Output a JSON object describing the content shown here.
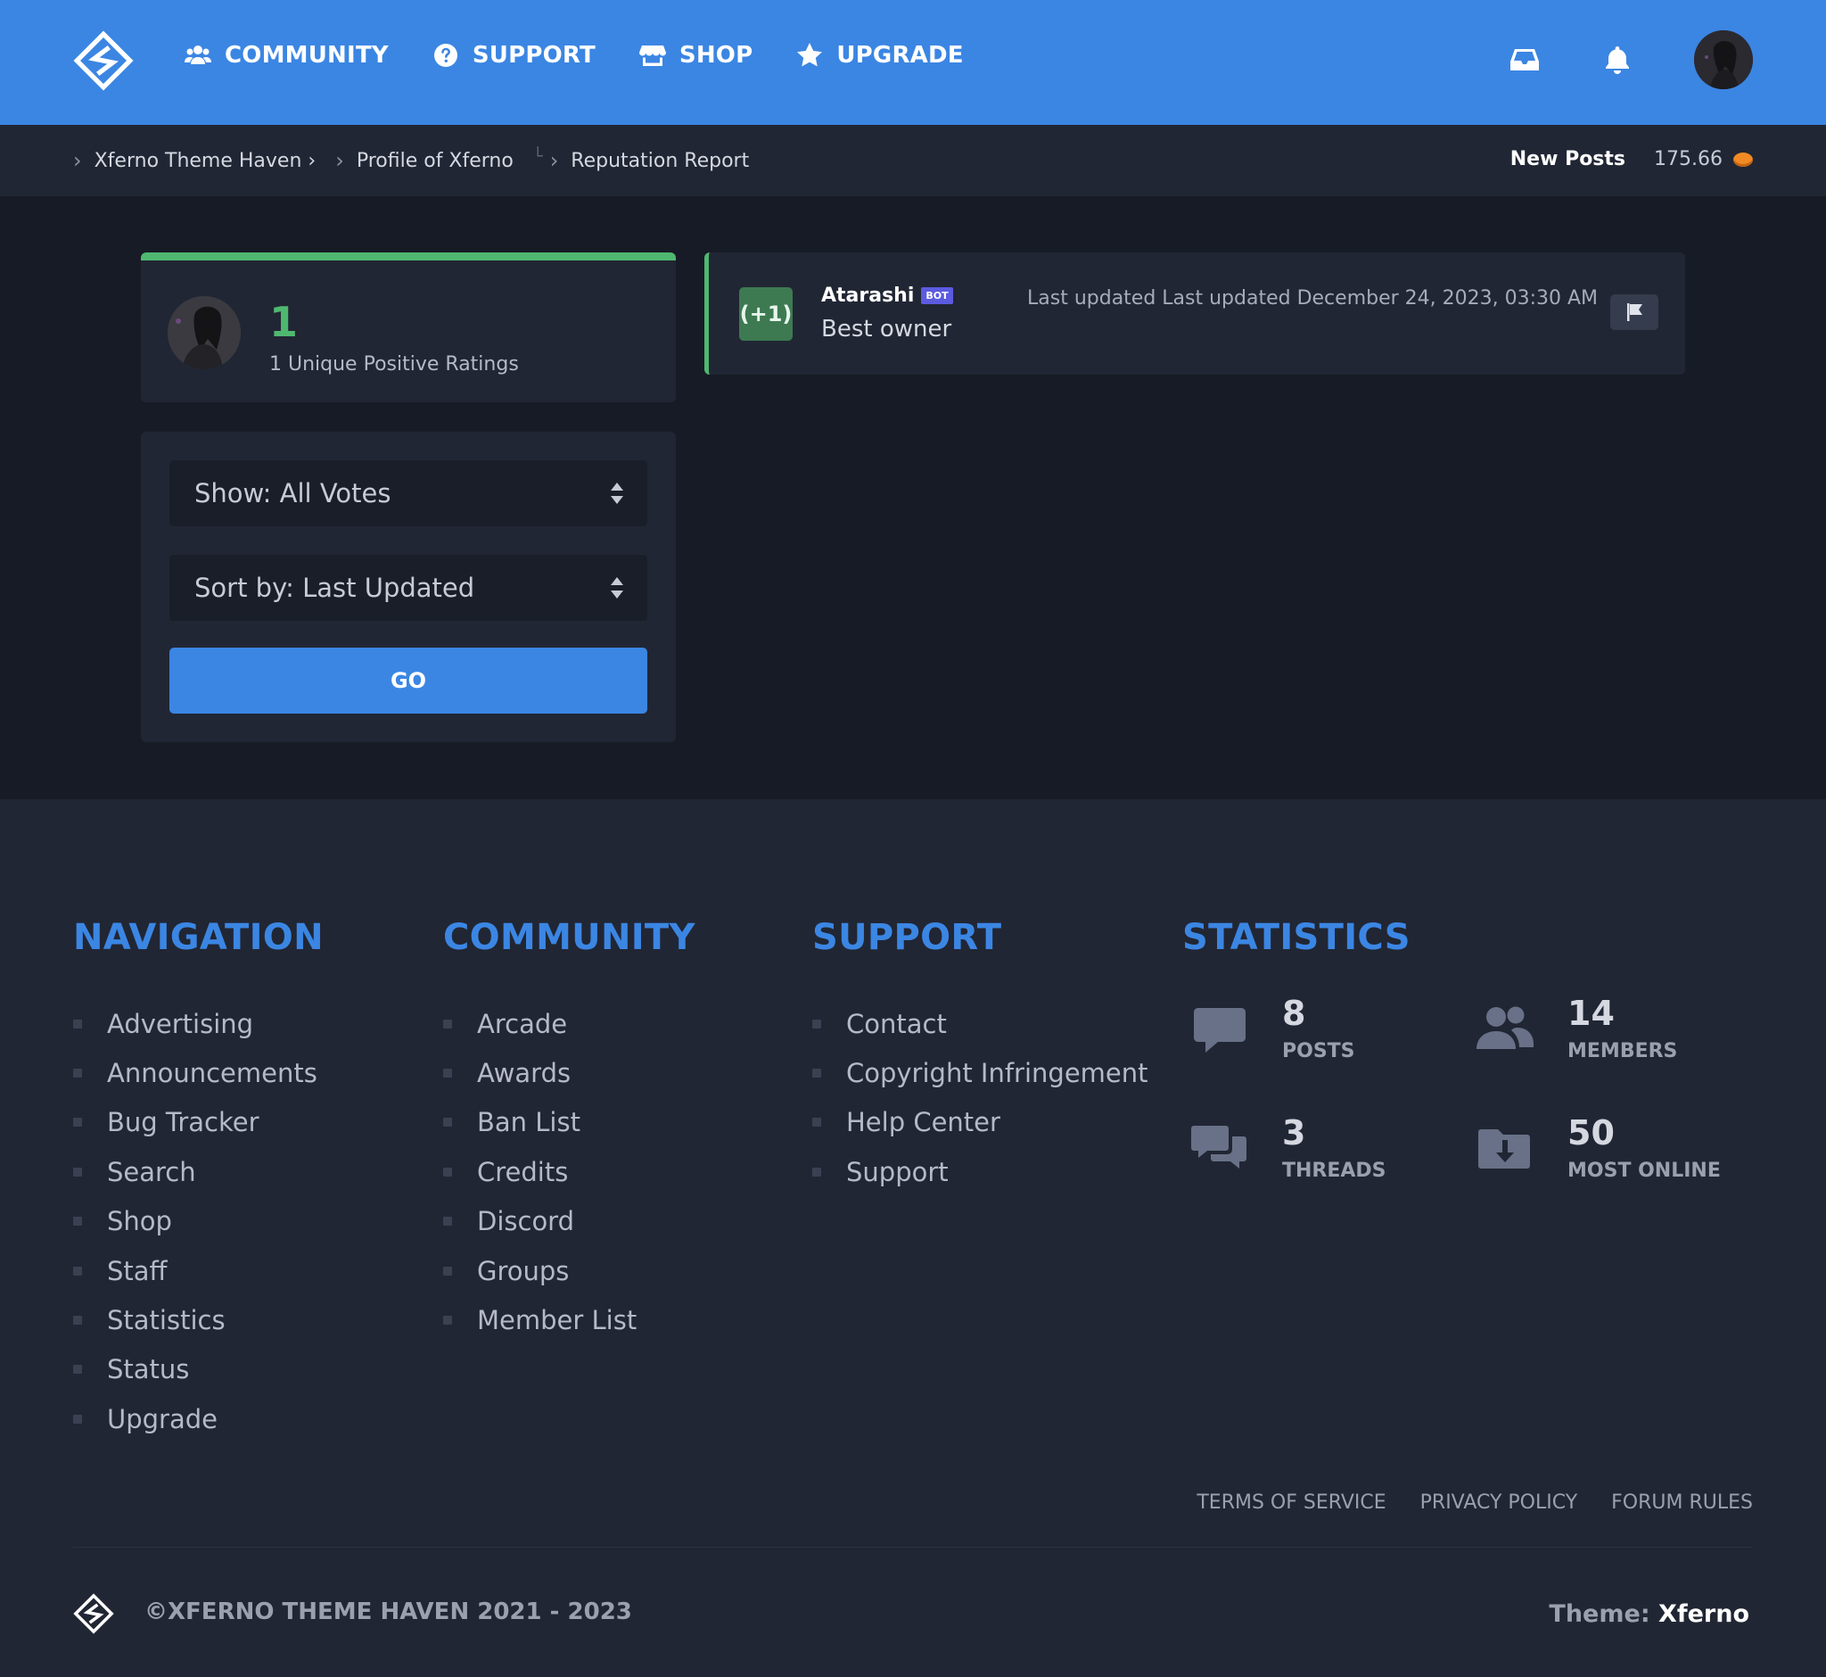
{
  "header": {
    "nav": [
      {
        "label": "Community",
        "icon": "users-icon"
      },
      {
        "label": "Support",
        "icon": "question-circle-icon"
      },
      {
        "label": "Shop",
        "icon": "store-icon"
      },
      {
        "label": "Upgrade",
        "icon": "star-icon"
      }
    ],
    "actions": [
      "inbox-icon",
      "bell-icon",
      "avatar"
    ]
  },
  "breadcrumb": {
    "items": [
      "Xferno Theme Haven ›",
      "Profile of Xferno",
      "Reputation Report"
    ],
    "new_posts": "New Posts",
    "credits": "175.66"
  },
  "summary": {
    "count": "1",
    "description": "1 Unique Positive Ratings"
  },
  "filters": {
    "show": "Show: All Votes",
    "sort": "Sort by: Last Updated",
    "go": "Go"
  },
  "reputation": {
    "badge": "(+1)",
    "user": "Atarashi",
    "user_tag": "BOT",
    "comment": "Best owner",
    "updated": "Last updated Last updated December 24, 2023, 03:30 AM"
  },
  "footer": {
    "navigation": {
      "title": "Navigation",
      "items": [
        "Advertising",
        "Announcements",
        "Bug Tracker",
        "Search",
        "Shop",
        "Staff",
        "Statistics",
        "Status",
        "Upgrade"
      ]
    },
    "community": {
      "title": "Community",
      "items": [
        "Arcade",
        "Awards",
        "Ban List",
        "Credits",
        "Discord",
        "Groups",
        "Member List"
      ]
    },
    "support": {
      "title": "Support",
      "items": [
        "Contact",
        "Copyright Infringement",
        "Help Center",
        "Support"
      ]
    },
    "statistics": {
      "title": "Statistics",
      "posts": {
        "value": "8",
        "label": "Posts"
      },
      "members": {
        "value": "14",
        "label": "Members"
      },
      "threads": {
        "value": "3",
        "label": "Threads"
      },
      "most_online": {
        "value": "50",
        "label": "Most Online"
      }
    },
    "legal": [
      "Terms of Service",
      "Privacy Policy",
      "Forum Rules"
    ],
    "copyright": "©Xferno Theme Haven 2021 - 2023",
    "theme_label": "Theme:",
    "theme_name": "Xferno"
  },
  "colors": {
    "brand": "#3b86e3",
    "positive": "#4fb870",
    "background": "#171b25",
    "panel": "#212634"
  }
}
